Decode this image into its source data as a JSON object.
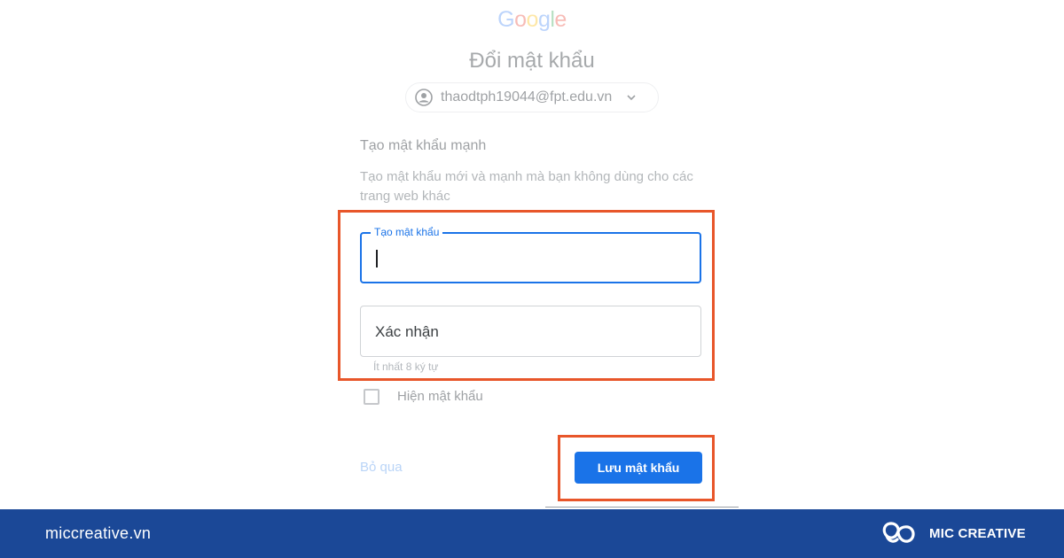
{
  "card": {
    "logo_letters": [
      "G",
      "o",
      "o",
      "g",
      "l",
      "e"
    ],
    "heading": "Đổi mật khẩu",
    "account_email": "thaodtph19044@fpt.edu.vn",
    "section_title": "Tạo mật khẩu mạnh",
    "section_desc": "Tạo mật khẩu mới và mạnh mà bạn không dùng cho các trang web khác",
    "password_field": {
      "label": "Tạo mật khẩu",
      "value": ""
    },
    "confirm_field": {
      "placeholder": "Xác nhận",
      "value": ""
    },
    "hint": "Ít nhất 8 ký tự",
    "show_password_label": "Hiện mật khẩu",
    "show_password_checked": false,
    "skip_label": "Bỏ qua",
    "save_label": "Lưu mật khẩu"
  },
  "highlight_color": "#e8562a",
  "accent_color": "#1a73e8",
  "footer": {
    "site": "miccreative.vn",
    "brand_name": "MIC CREATIVE",
    "background": "#1b4897"
  },
  "icons": {
    "account": "account-circle-icon",
    "dropdown": "chevron-down-icon",
    "brand": "mic-creative-logo-icon"
  }
}
